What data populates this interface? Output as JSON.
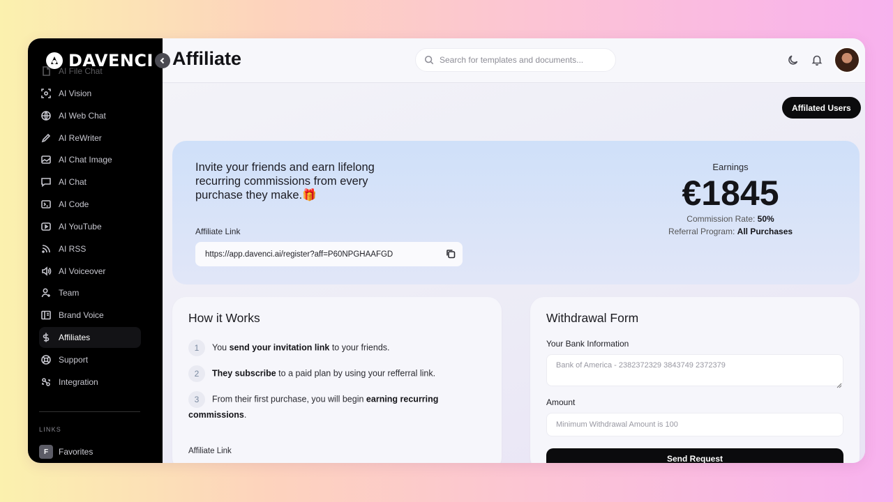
{
  "app": {
    "logo_text": "DAVENCI"
  },
  "sidebar": {
    "items": [
      {
        "label": "AI File Chat",
        "icon": "file-chat-icon"
      },
      {
        "label": "AI Vision",
        "icon": "scan-eye-icon"
      },
      {
        "label": "AI Web Chat",
        "icon": "www-globe-icon"
      },
      {
        "label": "AI ReWriter",
        "icon": "pen-icon"
      },
      {
        "label": "AI Chat Image",
        "icon": "image-icon"
      },
      {
        "label": "AI Chat",
        "icon": "chat-bubble-icon"
      },
      {
        "label": "AI Code",
        "icon": "terminal-icon"
      },
      {
        "label": "AI YouTube",
        "icon": "play-icon"
      },
      {
        "label": "AI RSS",
        "icon": "rss-icon"
      },
      {
        "label": "AI Voiceover",
        "icon": "speaker-icon"
      },
      {
        "label": "Team",
        "icon": "user-plus-icon"
      },
      {
        "label": "Brand Voice",
        "icon": "book-icon"
      },
      {
        "label": "Affiliates",
        "icon": "dollar-icon"
      },
      {
        "label": "Support",
        "icon": "lifebuoy-icon"
      },
      {
        "label": "Integration",
        "icon": "integration-icon"
      }
    ],
    "active_item": "Affiliates",
    "links_label": "LINKS",
    "favorites": {
      "badge": "F",
      "label": "Favorites"
    }
  },
  "header": {
    "title": "Affiliate",
    "search_placeholder": "Search for templates and documents..."
  },
  "affiliated_users_label": "Affilated Users",
  "hero": {
    "text": "Invite your friends and earn lifelong recurring commissions from every purchase they make.🎁",
    "affiliate_link_label": "Affiliate Link",
    "affiliate_link": "https://app.davenci.ai/register?aff=P60NPGHAAFGD",
    "earnings_label": "Earnings",
    "earnings_amount": "€1845",
    "commission_rate_label": "Commission Rate:",
    "commission_rate": "50%",
    "referral_program_label": "Referral Program:",
    "referral_program": "All Purchases"
  },
  "how_it_works": {
    "title": "How it Works",
    "steps": [
      {
        "num": "1",
        "pre": "You ",
        "bold": "send your invitation link",
        "post": " to your friends.",
        "bold2": "",
        "post2": ""
      },
      {
        "num": "2",
        "pre": "",
        "bold": "They subscribe",
        "post": " to a paid plan by using your refferral link.",
        "bold2": "",
        "post2": ""
      },
      {
        "num": "3",
        "pre": "From their first purchase, you will begin ",
        "bold": "earning recurring commissions",
        "post": ".",
        "bold2": "",
        "post2": ""
      }
    ],
    "affiliate_link_label": "Affiliate Link"
  },
  "withdrawal": {
    "title": "Withdrawal Form",
    "bank_label": "Your Bank Information",
    "bank_placeholder": "Bank of America - 2382372329 3843749 2372379",
    "amount_label": "Amount",
    "amount_placeholder": "Minimum Withdrawal Amount is 100",
    "send_label": "Send Request"
  },
  "colors": {
    "accent": "#0b0b0d",
    "sidebar_bg": "#000000",
    "hero_bg": "#cfe0f9"
  }
}
